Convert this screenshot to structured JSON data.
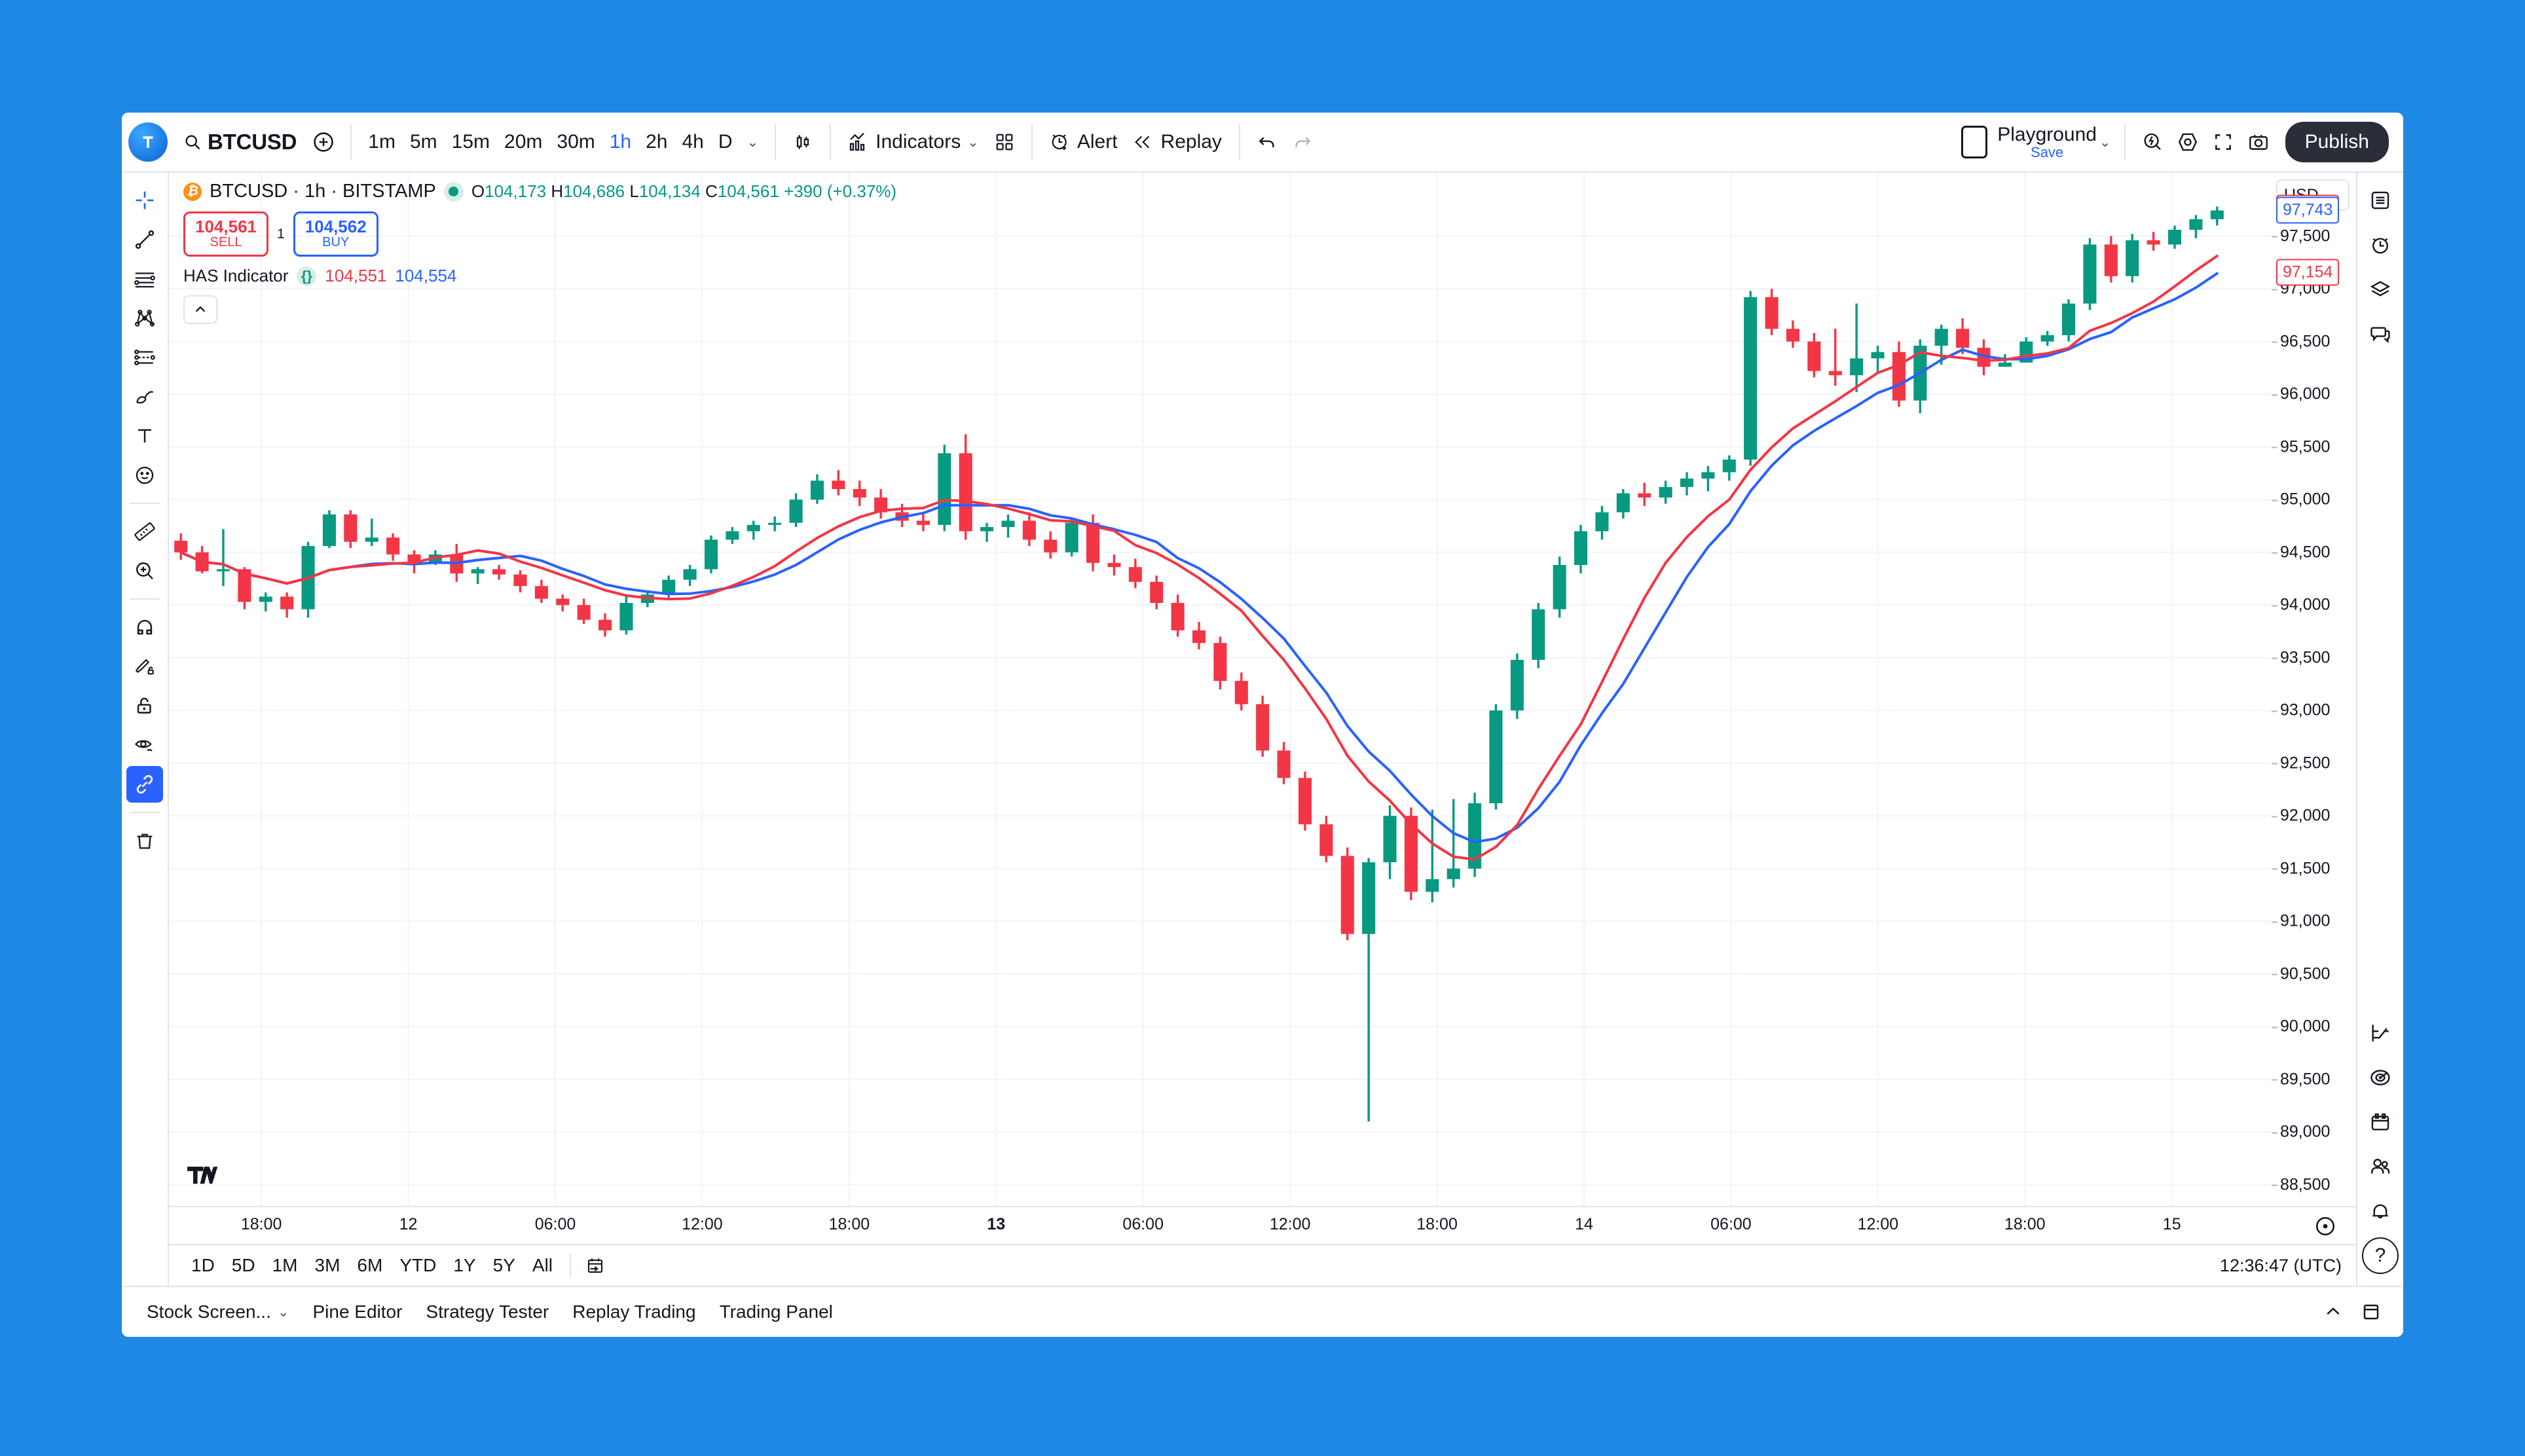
{
  "toolbar": {
    "symbol": "BTCUSD",
    "search_icon": "search-icon",
    "add_symbol_label": "+",
    "timeframes": [
      {
        "label": "1m",
        "active": false
      },
      {
        "label": "5m",
        "active": false
      },
      {
        "label": "15m",
        "active": false
      },
      {
        "label": "20m",
        "active": false
      },
      {
        "label": "30m",
        "active": false
      },
      {
        "label": "1h",
        "active": true
      },
      {
        "label": "2h",
        "active": false
      },
      {
        "label": "4h",
        "active": false
      },
      {
        "label": "D",
        "active": false
      }
    ],
    "timeframe_more": "⌄",
    "chart_type_icon": "candlestick-icon",
    "indicators_label": "Indicators",
    "indicators_chevron": "⌄",
    "templates_icon": "grid-templates-icon",
    "alert_label": "Alert",
    "replay_label": "Replay",
    "undo_icon": "undo-icon",
    "redo_icon": "redo-icon",
    "layout_icon": "layout-icon",
    "playground_name": "Playground",
    "playground_save": "Save",
    "playground_chevron": "⌄",
    "quick_search_icon": "fast-search-icon",
    "settings_icon": "gear-icon",
    "fullscreen_icon": "fullscreen-icon",
    "snapshot_icon": "camera-icon",
    "publish_label": "Publish"
  },
  "left_tools": [
    {
      "name": "cross-cursor-icon",
      "selected": false
    },
    {
      "name": "trend-line-icon",
      "selected": false
    },
    {
      "name": "horizontal-lines-icon",
      "selected": false
    },
    {
      "name": "pattern-icon",
      "selected": false
    },
    {
      "name": "prediction-icon",
      "selected": false
    },
    {
      "name": "brush-icon",
      "selected": false
    },
    {
      "name": "text-icon",
      "selected": false
    },
    {
      "name": "emoji-icon",
      "selected": false
    },
    {
      "name": "measure-ruler-icon",
      "selected": false
    },
    {
      "name": "zoom-in-icon",
      "selected": false
    },
    {
      "name": "magnet-icon",
      "selected": false
    },
    {
      "name": "stay-in-drawing-mode-icon",
      "selected": false
    },
    {
      "name": "lock-drawings-icon",
      "selected": false
    },
    {
      "name": "hide-drawings-icon",
      "selected": false
    },
    {
      "name": "link-icon",
      "selected": true
    },
    {
      "name": "remove-drawings-icon",
      "selected": false
    }
  ],
  "right_tools_top": [
    "watchlist-icon",
    "alerts-clock-icon",
    "data-window-layers-icon",
    "chat-icon"
  ],
  "right_tools_bottom": [
    "ideas-icon",
    "hotlist-icon",
    "calendar-icon",
    "public-chats-icon",
    "notifications-bell-icon",
    "help-icon"
  ],
  "legend": {
    "coin_symbol": "₿",
    "title": "BTCUSD · 1h · BITSTAMP",
    "status_dot": "market-open-dot",
    "o_label": "O",
    "h_label": "H",
    "l_label": "L",
    "c_label": "C",
    "open": "104,173",
    "high": "104,686",
    "low": "104,134",
    "close": "104,561",
    "change_abs": "+390",
    "change_pct": "(+0.37%)",
    "sell_price": "104,561",
    "sell_label": "SELL",
    "quantity": "1",
    "buy_price": "104,562",
    "buy_label": "BUY",
    "indicator_name": "HAS Indicator",
    "indicator_source_icon": "{}",
    "indicator_value_1": "104,551",
    "indicator_value_2": "104,554",
    "collapse_icon": "chevron-up-icon"
  },
  "price_axis": {
    "currency": "USD",
    "currency_chevron": "⌄",
    "ticks": [
      "97,500",
      "97,000",
      "96,500",
      "96,000",
      "95,500",
      "95,000",
      "94,500",
      "94,000",
      "93,500",
      "93,000",
      "92,500",
      "92,000",
      "91,500",
      "91,000",
      "90,500",
      "90,000",
      "89,500",
      "89,000",
      "88,500"
    ],
    "labels": [
      {
        "value": "97,766",
        "color": "red"
      },
      {
        "value": "97,743",
        "color": "blue"
      },
      {
        "value": "97,154",
        "color": "red"
      }
    ]
  },
  "time_axis": {
    "labels": [
      {
        "text": "18:00",
        "bold": false
      },
      {
        "text": "12",
        "bold": false
      },
      {
        "text": "06:00",
        "bold": false
      },
      {
        "text": "12:00",
        "bold": false
      },
      {
        "text": "18:00",
        "bold": false
      },
      {
        "text": "13",
        "bold": true
      },
      {
        "text": "06:00",
        "bold": false
      },
      {
        "text": "12:00",
        "bold": false
      },
      {
        "text": "18:00",
        "bold": false
      },
      {
        "text": "14",
        "bold": false
      },
      {
        "text": "06:00",
        "bold": false
      },
      {
        "text": "12:00",
        "bold": false
      },
      {
        "text": "18:00",
        "bold": false
      },
      {
        "text": "15",
        "bold": false
      }
    ],
    "clock_icon": "timezone-clock-icon"
  },
  "range_bar": {
    "ranges": [
      "1D",
      "5D",
      "1M",
      "3M",
      "6M",
      "YTD",
      "1Y",
      "5Y",
      "All"
    ],
    "goto_icon": "go-to-date-icon",
    "clock_text": "12:36:47 (UTC)"
  },
  "footer": {
    "tabs": [
      {
        "label": "Stock Screen...",
        "chevron": "⌄"
      },
      {
        "label": "Pine Editor",
        "chevron": ""
      },
      {
        "label": "Strategy Tester",
        "chevron": ""
      },
      {
        "label": "Replay Trading",
        "chevron": ""
      },
      {
        "label": "Trading Panel",
        "chevron": ""
      }
    ],
    "collapse_icon": "chevron-up-icon",
    "maximize_icon": "maximize-icon",
    "help_label": "?"
  },
  "colors": {
    "bull": "#089981",
    "bear": "#F23645",
    "ma_fast": "#F23645",
    "ma_slow": "#2962FF",
    "accent": "#2962FF",
    "app_bg": "#1E88E5",
    "grid": "#F0F3FA"
  },
  "chart_data": {
    "type": "candlestick",
    "title": "BTCUSD · 1h · BITSTAMP",
    "xlabel": "",
    "ylabel": "USD",
    "ylim": [
      88300,
      98100
    ],
    "grid": true,
    "legend": "top-left",
    "price_scale_ticks": [
      97500,
      97000,
      96500,
      96000,
      95500,
      95000,
      94500,
      94000,
      93500,
      93000,
      92500,
      92000,
      91500,
      91000,
      90500,
      90000,
      89500,
      89000,
      88500
    ],
    "time_ticks": [
      "18:00",
      "12",
      "06:00",
      "12:00",
      "18:00",
      "13",
      "06:00",
      "12:00",
      "18:00",
      "14",
      "06:00",
      "12:00",
      "18:00",
      "15"
    ],
    "series": [
      {
        "name": "Candles",
        "type": "candlestick",
        "ohlc": [
          [
            94610,
            94680,
            94430,
            94500
          ],
          [
            94500,
            94560,
            94300,
            94320
          ],
          [
            94320,
            94720,
            94180,
            94340
          ],
          [
            94340,
            94360,
            93960,
            94030
          ],
          [
            94030,
            94120,
            93940,
            94080
          ],
          [
            94080,
            94120,
            93880,
            93960
          ],
          [
            93960,
            94600,
            93880,
            94560
          ],
          [
            94560,
            94900,
            94540,
            94860
          ],
          [
            94860,
            94900,
            94540,
            94600
          ],
          [
            94600,
            94820,
            94560,
            94640
          ],
          [
            94640,
            94680,
            94420,
            94480
          ],
          [
            94480,
            94520,
            94300,
            94400
          ],
          [
            94400,
            94520,
            94380,
            94480
          ],
          [
            94480,
            94580,
            94220,
            94300
          ],
          [
            94300,
            94360,
            94200,
            94340
          ],
          [
            94340,
            94380,
            94240,
            94290
          ],
          [
            94290,
            94330,
            94120,
            94180
          ],
          [
            94180,
            94240,
            94020,
            94060
          ],
          [
            94060,
            94100,
            93940,
            94000
          ],
          [
            94000,
            94060,
            93820,
            93860
          ],
          [
            93860,
            93920,
            93700,
            93760
          ],
          [
            93760,
            94080,
            93720,
            94020
          ],
          [
            94020,
            94140,
            93980,
            94100
          ],
          [
            94100,
            94280,
            94060,
            94240
          ],
          [
            94240,
            94380,
            94180,
            94340
          ],
          [
            94340,
            94660,
            94300,
            94620
          ],
          [
            94620,
            94740,
            94580,
            94700
          ],
          [
            94700,
            94800,
            94620,
            94760
          ],
          [
            94760,
            94840,
            94700,
            94780
          ],
          [
            94780,
            95060,
            94740,
            95000
          ],
          [
            95000,
            95240,
            94960,
            95180
          ],
          [
            95180,
            95280,
            95040,
            95100
          ],
          [
            95100,
            95180,
            94940,
            95020
          ],
          [
            95020,
            95100,
            94820,
            94880
          ],
          [
            94880,
            94960,
            94740,
            94800
          ],
          [
            94800,
            94880,
            94700,
            94760
          ],
          [
            94760,
            95520,
            94700,
            95440
          ],
          [
            95440,
            95620,
            94620,
            94700
          ],
          [
            94700,
            94780,
            94600,
            94740
          ],
          [
            94740,
            94860,
            94640,
            94800
          ],
          [
            94800,
            94880,
            94560,
            94620
          ],
          [
            94620,
            94700,
            94440,
            94500
          ],
          [
            94500,
            94820,
            94460,
            94780
          ],
          [
            94780,
            94860,
            94320,
            94400
          ],
          [
            94400,
            94480,
            94280,
            94360
          ],
          [
            94360,
            94440,
            94160,
            94220
          ],
          [
            94220,
            94280,
            93960,
            94020
          ],
          [
            94020,
            94100,
            93700,
            93760
          ],
          [
            93760,
            93840,
            93580,
            93640
          ],
          [
            93640,
            93700,
            93200,
            93280
          ],
          [
            93280,
            93360,
            93000,
            93060
          ],
          [
            93060,
            93140,
            92560,
            92620
          ],
          [
            92620,
            92700,
            92300,
            92360
          ],
          [
            92360,
            92420,
            91860,
            91920
          ],
          [
            91920,
            92000,
            91560,
            91620
          ],
          [
            91620,
            91700,
            90820,
            90880
          ],
          [
            90880,
            91600,
            89100,
            91560
          ],
          [
            91560,
            92100,
            91400,
            92000
          ],
          [
            92000,
            92080,
            91200,
            91280
          ],
          [
            91280,
            92060,
            91180,
            91400
          ],
          [
            91400,
            92160,
            91320,
            91500
          ],
          [
            91500,
            92220,
            91420,
            92120
          ],
          [
            92120,
            93060,
            92060,
            93000
          ],
          [
            93000,
            93540,
            92920,
            93480
          ],
          [
            93480,
            94020,
            93400,
            93960
          ],
          [
            93960,
            94460,
            93880,
            94380
          ],
          [
            94380,
            94760,
            94300,
            94700
          ],
          [
            94700,
            94940,
            94620,
            94880
          ],
          [
            94880,
            95100,
            94820,
            95060
          ],
          [
            95060,
            95160,
            94940,
            95020
          ],
          [
            95020,
            95180,
            94960,
            95120
          ],
          [
            95120,
            95260,
            95040,
            95200
          ],
          [
            95200,
            95320,
            95080,
            95260
          ],
          [
            95260,
            95420,
            95180,
            95380
          ],
          [
            95380,
            96980,
            95320,
            96920
          ],
          [
            96920,
            97000,
            96560,
            96620
          ],
          [
            96620,
            96700,
            96440,
            96500
          ],
          [
            96500,
            96580,
            96160,
            96220
          ],
          [
            96220,
            96620,
            96080,
            96180
          ],
          [
            96180,
            96860,
            96020,
            96340
          ],
          [
            96340,
            96460,
            96200,
            96400
          ],
          [
            96400,
            96500,
            95880,
            95940
          ],
          [
            95940,
            96520,
            95820,
            96460
          ],
          [
            96460,
            96660,
            96280,
            96620
          ],
          [
            96620,
            96720,
            96380,
            96440
          ],
          [
            96440,
            96520,
            96180,
            96260
          ],
          [
            96260,
            96380,
            96260,
            96300
          ],
          [
            96300,
            96540,
            96340,
            96500
          ],
          [
            96500,
            96600,
            96460,
            96560
          ],
          [
            96560,
            96900,
            96500,
            96860
          ],
          [
            96860,
            97480,
            96800,
            97420
          ],
          [
            97420,
            97500,
            97060,
            97120
          ],
          [
            97120,
            97520,
            97060,
            97460
          ],
          [
            97460,
            97540,
            97360,
            97420
          ],
          [
            97420,
            97600,
            97380,
            97560
          ],
          [
            97560,
            97700,
            97480,
            97660
          ],
          [
            97660,
            97780,
            97600,
            97743
          ]
        ]
      },
      {
        "name": "MA Fast",
        "type": "line",
        "color": "#F23645",
        "last_value": 97766
      },
      {
        "name": "MA Slow",
        "type": "line",
        "color": "#2962FF",
        "last_value": 97743
      }
    ],
    "annotations": [
      {
        "label": "97,766",
        "type": "price-line-label",
        "color": "#F23645"
      },
      {
        "label": "97,743",
        "type": "price-line-label",
        "color": "#2962FF"
      },
      {
        "label": "97,154",
        "type": "last-price-label",
        "color": "#F23645"
      }
    ]
  }
}
